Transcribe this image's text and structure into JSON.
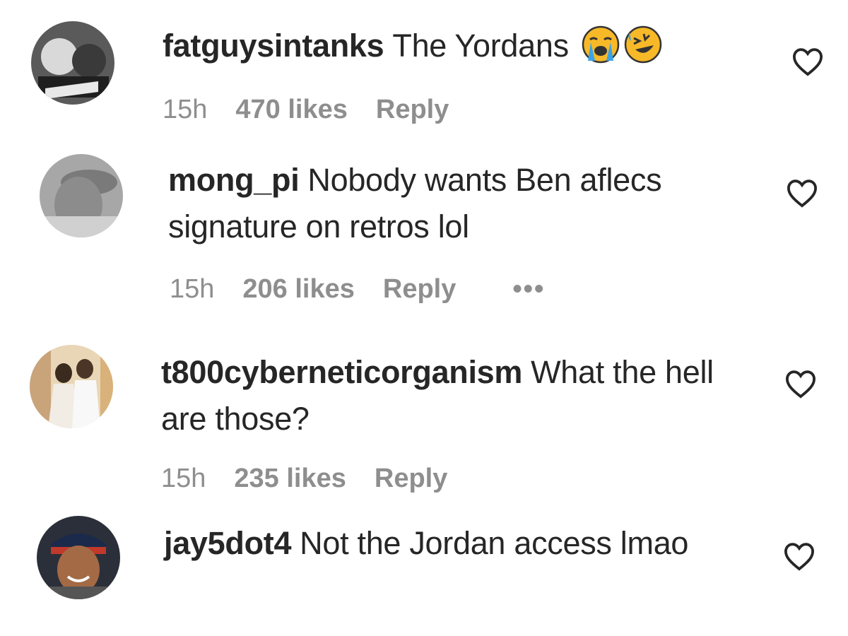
{
  "comments": [
    {
      "username": "fatguysintanks",
      "text": "The Yordans",
      "emojis": [
        "loudly-crying-face-emoji",
        "rolling-on-floor-laughing-emoji"
      ],
      "time": "15h",
      "likes": "470 likes",
      "reply": "Reply",
      "avatar": "user-avatar-fatguysintanks"
    },
    {
      "username": "mong_pi",
      "text": "Nobody wants Ben aflecs signature on retros lol",
      "time": "15h",
      "likes": "206 likes",
      "reply": "Reply",
      "more": "•••",
      "avatar": "user-avatar-mong_pi"
    },
    {
      "username": "t800cyberneticorganism",
      "text": "What the hell are those?",
      "time": "15h",
      "likes": "235 likes",
      "reply": "Reply",
      "avatar": "user-avatar-t800cyberneticorganism"
    },
    {
      "username": "jay5dot4",
      "text": "Not the Jordan access lmao",
      "avatar": "user-avatar-jay5dot4"
    }
  ],
  "icons": {
    "like": "heart-outline-icon",
    "more": "more-options-icon"
  },
  "colors": {
    "text": "#262626",
    "meta": "#8e8e8e",
    "background": "#ffffff"
  }
}
